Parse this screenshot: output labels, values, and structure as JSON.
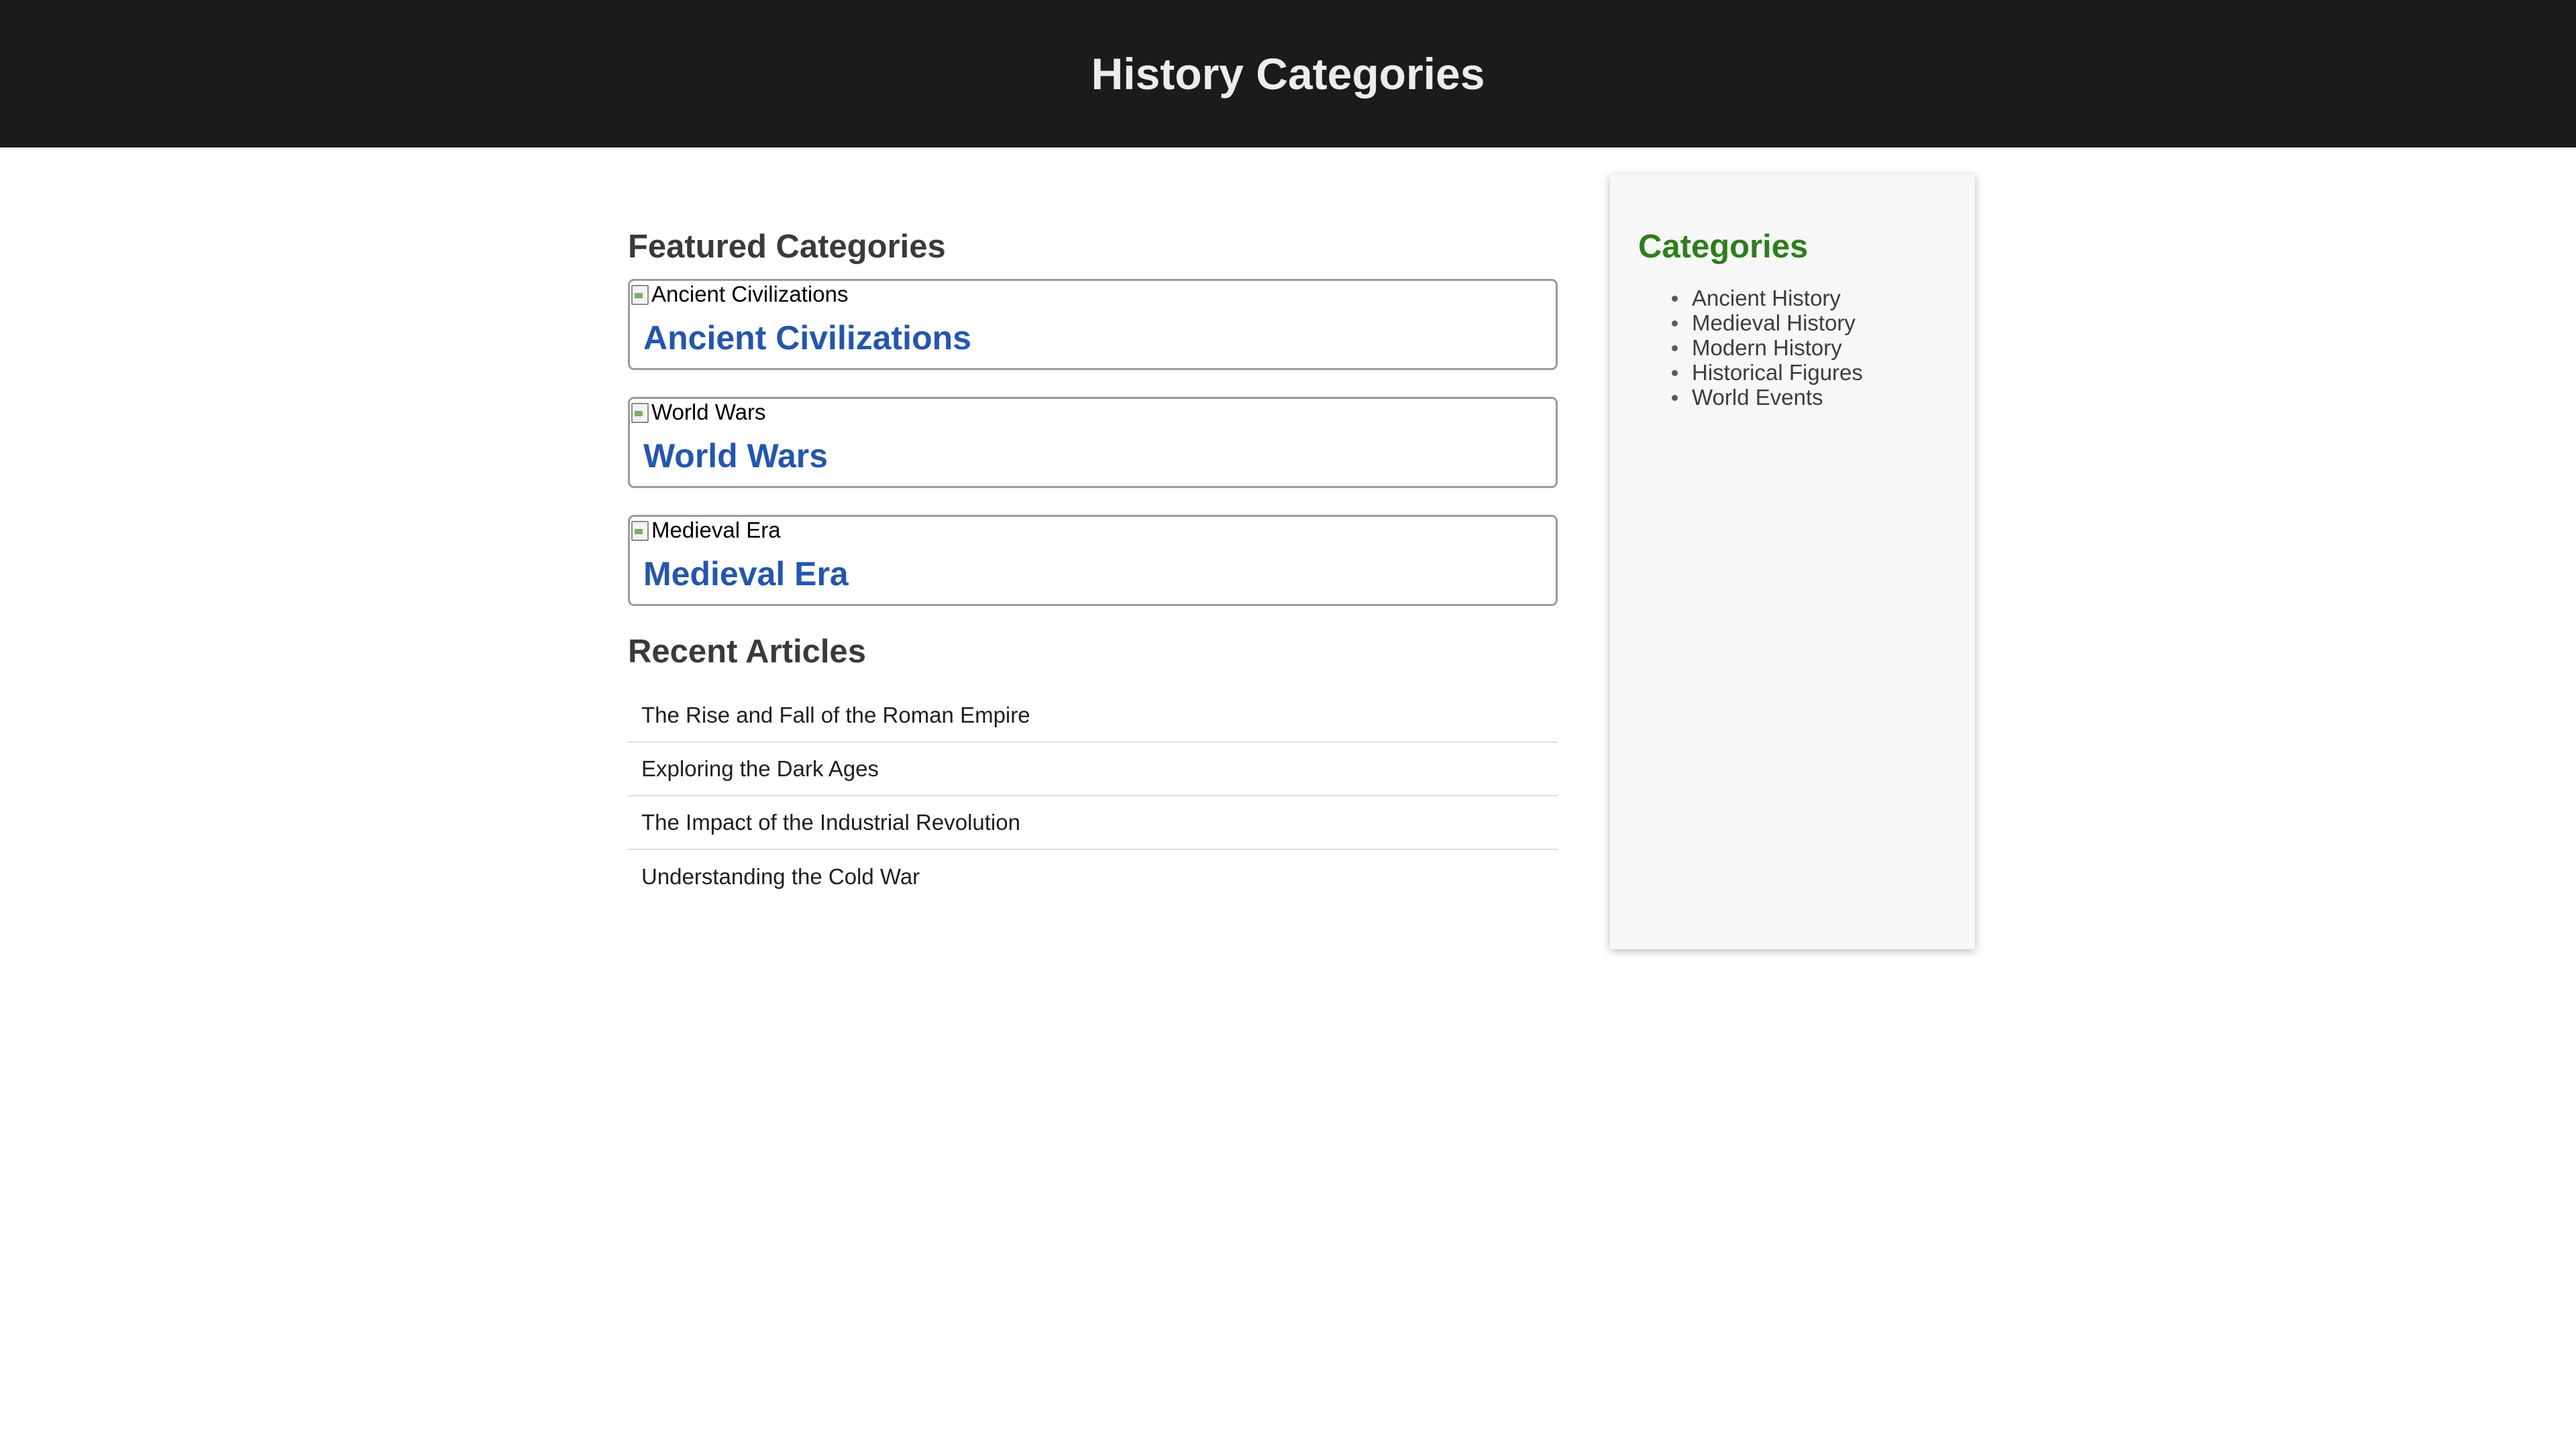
{
  "header": {
    "title": "History Categories"
  },
  "featured": {
    "heading": "Featured Categories",
    "cards": [
      {
        "image_alt": "Ancient Civilizations",
        "title": "Ancient Civilizations"
      },
      {
        "image_alt": "World Wars",
        "title": "World Wars"
      },
      {
        "image_alt": "Medieval Era",
        "title": "Medieval Era"
      }
    ]
  },
  "recent": {
    "heading": "Recent Articles",
    "articles": [
      "The Rise and Fall of the Roman Empire",
      "Exploring the Dark Ages",
      "The Impact of the Industrial Revolution",
      "Understanding the Cold War"
    ]
  },
  "sidebar": {
    "heading": "Categories",
    "items": [
      "Ancient History",
      "Medieval History",
      "Modern History",
      "Historical Figures",
      "World Events"
    ]
  },
  "colors": {
    "header_bg": "#1b1b1b",
    "link_blue": "#2456ad",
    "sidebar_heading_green": "#2f7e1d"
  },
  "icons": {
    "card_image": "broken-image-icon"
  }
}
